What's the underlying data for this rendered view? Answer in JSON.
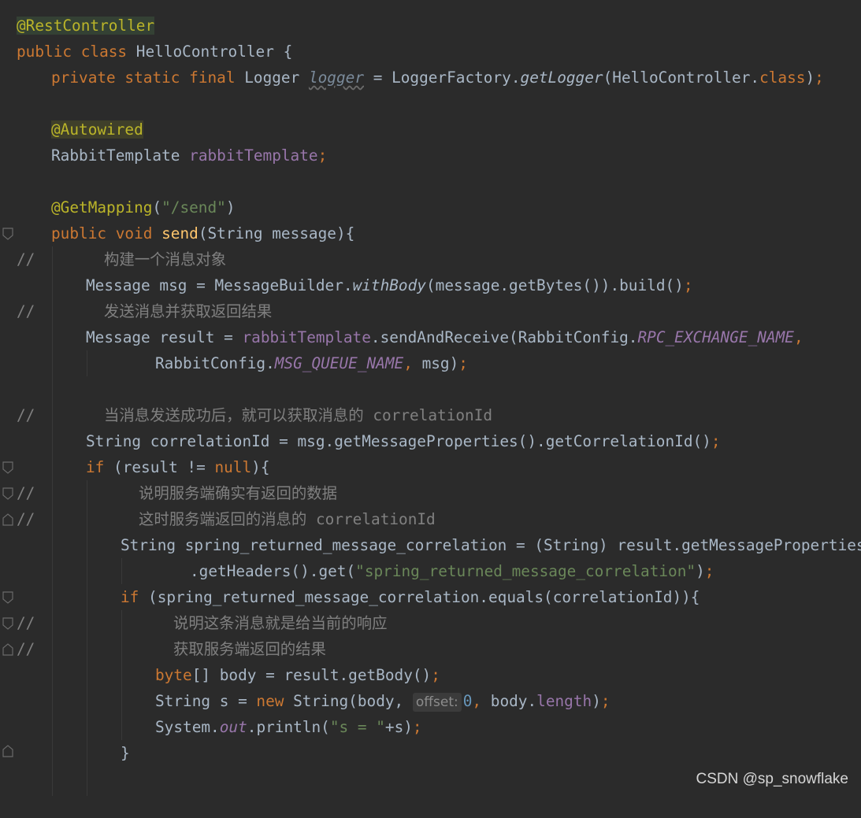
{
  "editor": {
    "language": "java",
    "background": "#2b2b2b",
    "colors": {
      "keyword": "#cc7832",
      "annotation": "#bbb529",
      "string": "#6a8759",
      "field": "#9876aa",
      "number": "#6897bb",
      "method_decl": "#ffc66d",
      "comment": "#808080",
      "text": "#a9b7c6"
    },
    "tokens": {
      "rest_controller": "@RestController",
      "public": "public",
      "class": "class",
      "hello_controller": "HelloController",
      "open_brace": "{",
      "private": "private",
      "static": "static",
      "final": "final",
      "logger_type": "Logger",
      "logger_field": "logger",
      "eq": "=",
      "logger_factory": "LoggerFactory.",
      "get_logger": "getLogger",
      "hello_controller_class_arg": "(HelloController.",
      "class_kw": "class",
      "close_paren": ")",
      "semicolon": ";",
      "autowired": "@Autowired",
      "rabbit_template_type": "RabbitTemplate",
      "rabbit_template_field": "rabbitTemplate",
      "get_mapping": "@GetMapping",
      "open_paren": "(",
      "send_path": "\"/send\"",
      "void": "void",
      "send_method": "send",
      "send_params": "(String message){",
      "comment_prefix": "//",
      "comment_1": "构建一个消息对象",
      "msg_decl": "Message msg = MessageBuilder.",
      "with_body": "withBody",
      "msg_rest": "(message.getBytes()).build()",
      "comment_2": "发送消息并获取返回结果",
      "result_decl": "Message result = ",
      "send_and_receive": ".sendAndReceive(RabbitConfig.",
      "rpc_exchange_name": "RPC_EXCHANGE_NAME",
      "comma": ",",
      "rabbit_config": "RabbitConfig.",
      "msg_queue_name": "MSG_QUEUE_NAME",
      "msg_arg": " msg)",
      "comment_3": "当消息发送成功后，就可以获取消息的 correlationId",
      "correlation_decl": "String correlationId = msg.getMessageProperties().getCorrelationId()",
      "if": "if",
      "result_ne": " (result != ",
      "null": "null",
      "close_brace_open": "){",
      "comment_4": "说明服务端确实有返回的数据",
      "comment_5": "这时服务端返回的消息的 correlationId",
      "spring_decl": "String spring_returned_message_correlation = (String) result.getMessageProperties()",
      "get_headers": ".getHeaders().get(",
      "spring_key": "\"spring_returned_message_correlation\"",
      "if_equals": " (spring_returned_message_correlation.equals(correlationId)){",
      "comment_6": "说明这条消息就是给当前的响应",
      "comment_7": "获取服务端返回的结果",
      "byte_kw": "byte",
      "body_decl": "[] body = result.getBody()",
      "string_s": "String s = ",
      "new": "new",
      "string_ctor": " String(body, ",
      "offset_hint": "offset:",
      "zero": "0",
      "body_dot": " body.",
      "length": "length",
      "system": "System.",
      "out": "out",
      "println": ".println(",
      "s_eq": "\"s = \"",
      "plus_s": "+s)",
      "close_brace": "}"
    }
  },
  "watermark": "CSDN @sp_snowflake"
}
